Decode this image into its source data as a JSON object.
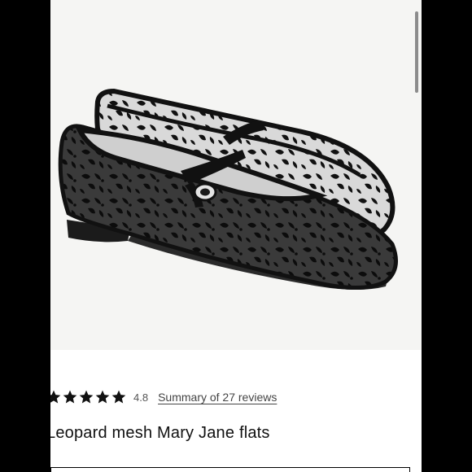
{
  "product": {
    "image_alt": "Leopard mesh Mary Jane flats product photo",
    "rating_value": "4.8",
    "star_count": 5,
    "reviews_link": "Summary of 27 reviews",
    "title": "Leopard mesh Mary Jane flats"
  },
  "colors": {
    "background": "#ffffff",
    "frame": "#000000",
    "photo_bg": "#f5f5f3",
    "star": "#111111",
    "scrollbar": "#8c8c8c"
  }
}
